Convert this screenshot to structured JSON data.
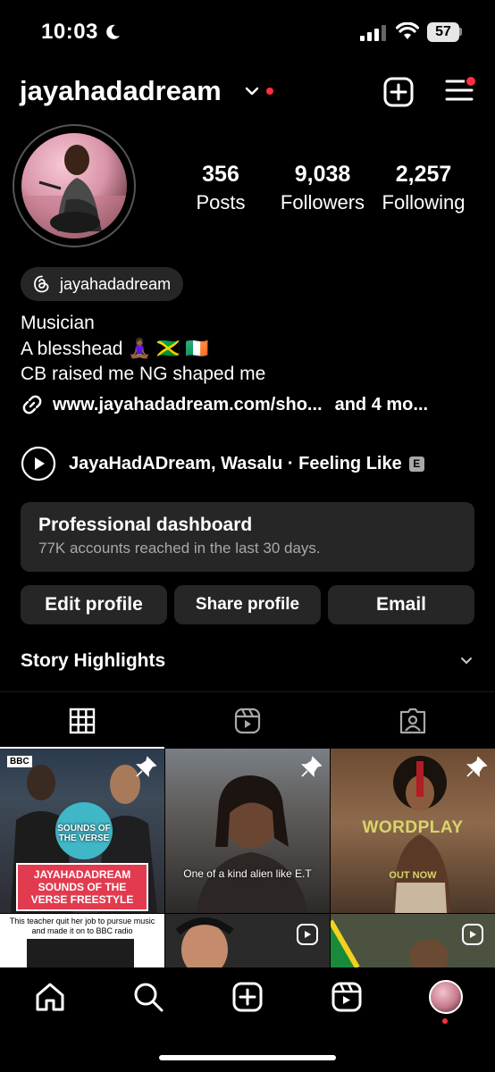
{
  "status_bar": {
    "time": "10:03",
    "battery": "57"
  },
  "header": {
    "username": "jayahadadream"
  },
  "stats": [
    {
      "value": "356",
      "label": "Posts"
    },
    {
      "value": "9,038",
      "label": "Followers"
    },
    {
      "value": "2,257",
      "label": "Following"
    }
  ],
  "threads": {
    "handle": "jayahadadream"
  },
  "bio": {
    "line1": "Musician",
    "line2": "A blesshead 🧘🏾‍♀️ 🇯🇲 🇮🇪",
    "line3": "CB raised me NG shaped me"
  },
  "link": {
    "url": "www.jayahadadream.com/sho...",
    "more": "and 4 mo..."
  },
  "music": {
    "track": "JayaHadADream, Wasalu · Feeling Like",
    "explicit_badge": "E"
  },
  "dashboard": {
    "title": "Professional dashboard",
    "subtitle": "77K accounts reached in the last 30 days."
  },
  "actions": {
    "edit": "Edit profile",
    "share": "Share profile",
    "email": "Email"
  },
  "highlights": {
    "title": "Story Highlights"
  },
  "grid": {
    "tile1": {
      "header": "BBC",
      "badge": "SOUNDS OF THE VERSE",
      "caption": "JAYAHADADREAM SOUNDS OF THE VERSE FREESTYLE"
    },
    "tile2": {
      "caption": "One of a kind alien like E.T"
    },
    "tile3": {
      "caption": "WORDPLAY",
      "sub": "OUT NOW"
    },
    "tile4": {
      "caption": "This teacher quit her job to pursue music and made it on to BBC radio"
    }
  }
}
